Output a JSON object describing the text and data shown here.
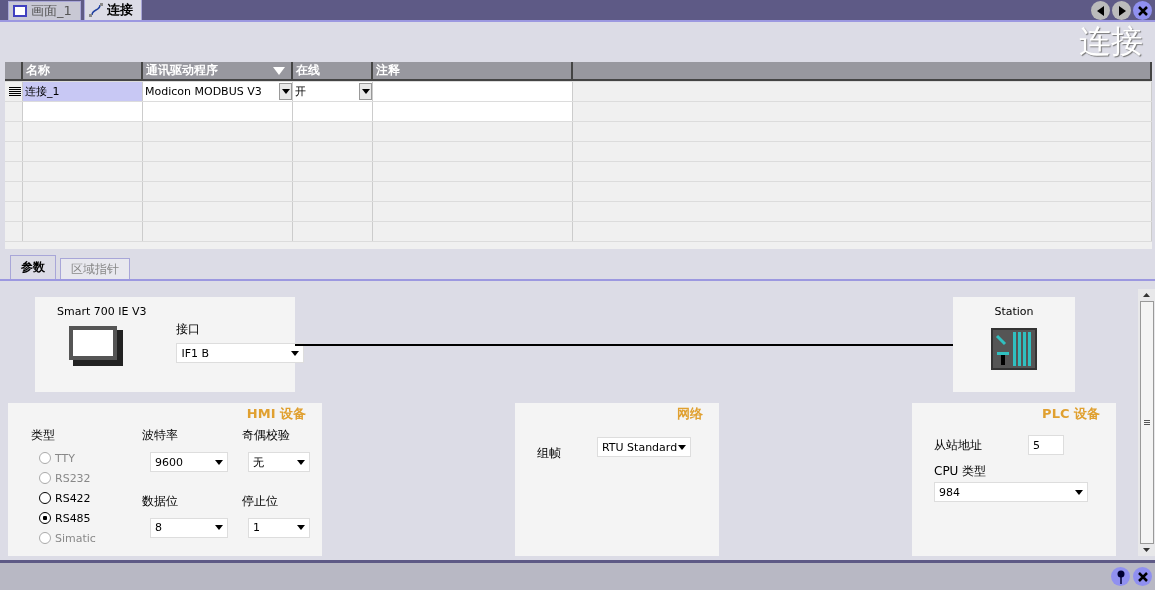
{
  "editor_tabs": [
    {
      "label": "画面_1",
      "selected": false
    },
    {
      "label": "连接",
      "selected": true
    }
  ],
  "title": "连接",
  "table": {
    "columns": [
      "名称",
      "通讯驱动程序",
      "在线",
      "注释"
    ],
    "rows": [
      {
        "selected": true,
        "cells": [
          {
            "kind": "text",
            "value": "连接_1"
          },
          {
            "kind": "dropdown",
            "value": "Modicon MODBUS V3"
          },
          {
            "kind": "dropdown",
            "value": "开"
          }
        ]
      }
    ]
  },
  "param_tabs": [
    {
      "label": "参数",
      "selected": true
    },
    {
      "label": "区域指针",
      "selected": false
    }
  ],
  "hmi_device": {
    "name": "Smart 700 IE V3",
    "interface_label": "接口",
    "interface": "IF1 B"
  },
  "station": {
    "name": "Station"
  },
  "hmi_settings": {
    "title": "HMI 设备",
    "type_label": "类型",
    "types": [
      {
        "label": "TTY",
        "selected": false,
        "disabled": true
      },
      {
        "label": "RS232",
        "selected": false,
        "disabled": true
      },
      {
        "label": "RS422",
        "selected": false,
        "disabled": false
      },
      {
        "label": "RS485",
        "selected": true,
        "disabled": false
      },
      {
        "label": "Simatic",
        "selected": false,
        "disabled": true
      }
    ],
    "fields": [
      {
        "label": "波特率",
        "value": "9600"
      },
      {
        "label": "奇偶校验",
        "value": "无"
      },
      {
        "label": "数据位",
        "value": "8"
      },
      {
        "label": "停止位",
        "value": "1"
      }
    ]
  },
  "network": {
    "title": "网络",
    "frame_label": "组帧",
    "frame": "RTU Standard"
  },
  "plc_device": {
    "title": "PLC 设备",
    "slave_label": "从站地址",
    "slave": "5",
    "cpu_label": "CPU 类型",
    "cpu": "984"
  }
}
